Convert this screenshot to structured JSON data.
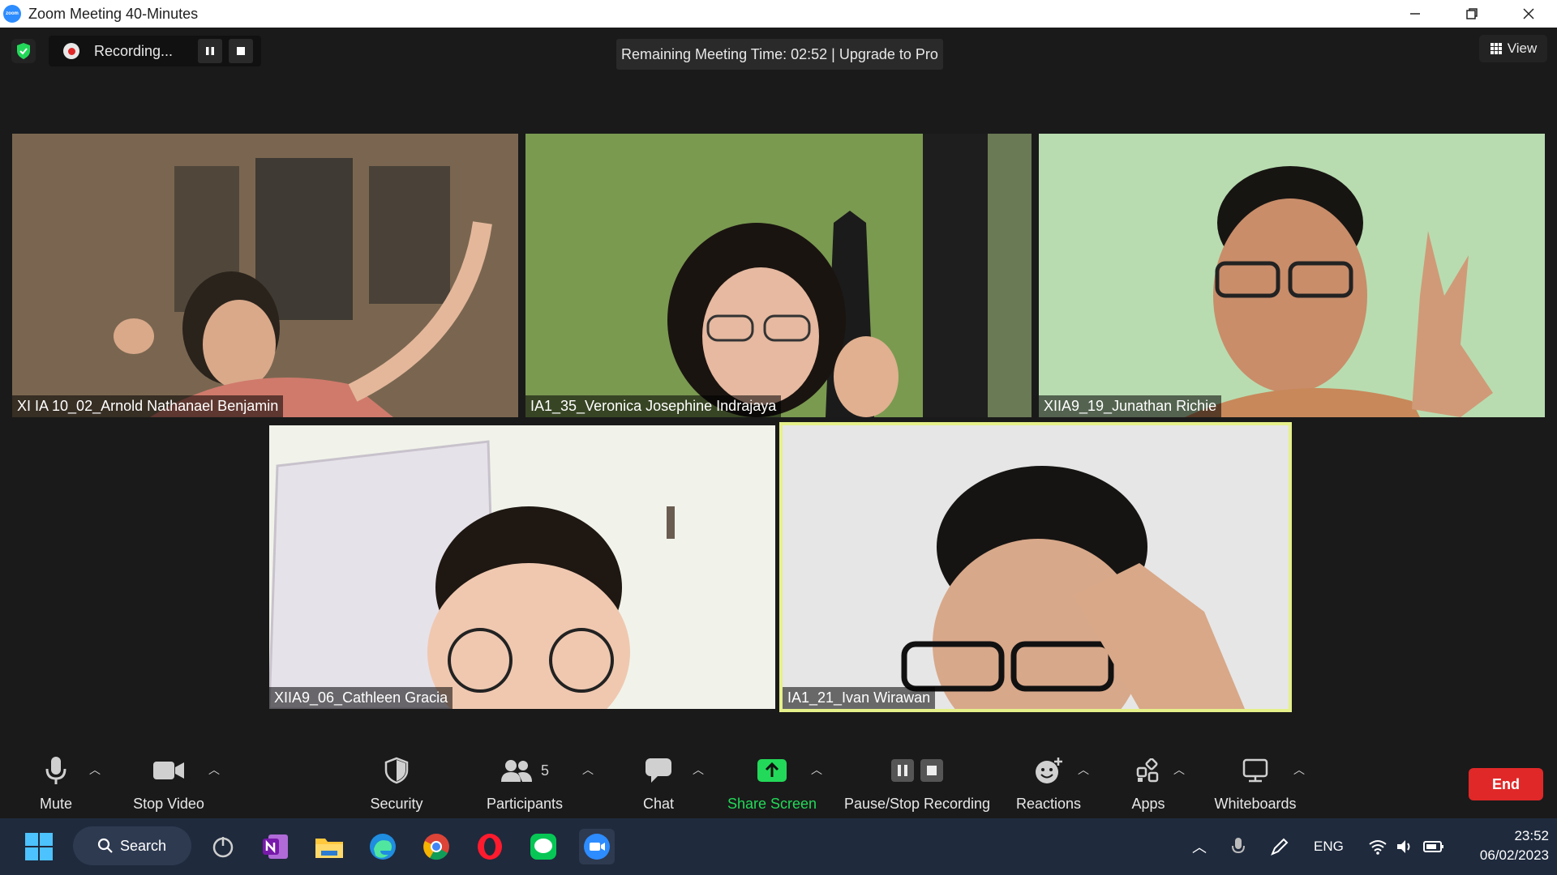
{
  "window": {
    "title": "Zoom Meeting 40-Minutes",
    "app_icon_text": "zoom"
  },
  "meeting": {
    "recording_label": "Recording...",
    "remaining_time": "Remaining Meeting Time: 02:52 | Upgrade to Pro",
    "view_label": "View"
  },
  "participants": [
    {
      "name": "XI IA 10_02_Arnold Nathanael Benjamin",
      "active": false
    },
    {
      "name": "IA1_35_Veronica Josephine Indrajaya",
      "active": false
    },
    {
      "name": "XIIA9_19_Junathan Richie",
      "active": false
    },
    {
      "name": "XIIA9_06_Cathleen Gracia",
      "active": false
    },
    {
      "name": "IA1_21_Ivan Wirawan",
      "active": true
    }
  ],
  "toolbar": {
    "mute": "Mute",
    "stop_video": "Stop Video",
    "security": "Security",
    "participants": "Participants",
    "participant_count": "5",
    "chat": "Chat",
    "share_screen": "Share Screen",
    "pause_stop_recording": "Pause/Stop Recording",
    "reactions": "Reactions",
    "apps": "Apps",
    "whiteboards": "Whiteboards",
    "end": "End"
  },
  "taskbar": {
    "search_label": "Search",
    "language": "ENG",
    "time": "23:52",
    "date": "06/02/2023"
  },
  "colors": {
    "share_green": "#23d959",
    "end_red": "#e02828",
    "active_border": "#e5f08a"
  }
}
